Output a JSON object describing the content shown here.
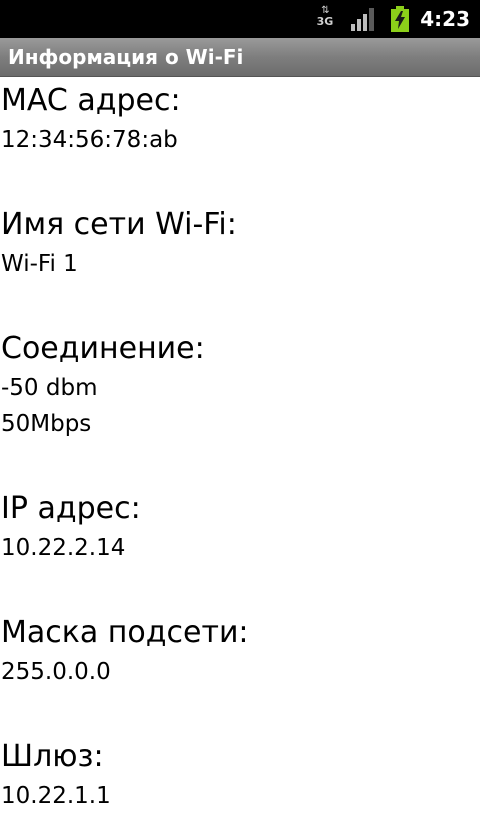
{
  "status_bar": {
    "network_type": "3G",
    "network_icon": "data-arrows-icon",
    "signal_icon": "signal-strength-icon",
    "battery_icon": "battery-charging-icon",
    "time": "4:23"
  },
  "title_bar": {
    "title": "Информация о Wi-Fi"
  },
  "fields": {
    "mac": {
      "label": "MAC адрес:",
      "value": "12:34:56:78:ab"
    },
    "ssid": {
      "label": "Имя сети Wi-Fi:",
      "value": "Wi-Fi 1"
    },
    "connection": {
      "label": "Соединение:",
      "signal": "-50 dbm",
      "speed": "50Mbps"
    },
    "ip": {
      "label": "IP адрес:",
      "value": "10.22.2.14"
    },
    "netmask": {
      "label": "Маска подсети:",
      "value": "255.0.0.0"
    },
    "gateway": {
      "label": "Шлюз:",
      "value": "10.22.1.1"
    }
  },
  "colors": {
    "status_bar_bg": "#000000",
    "title_bar_bg": "#7e7e7e",
    "battery_fill": "#8ccf1a",
    "background": "#ffffff",
    "text": "#000000"
  }
}
